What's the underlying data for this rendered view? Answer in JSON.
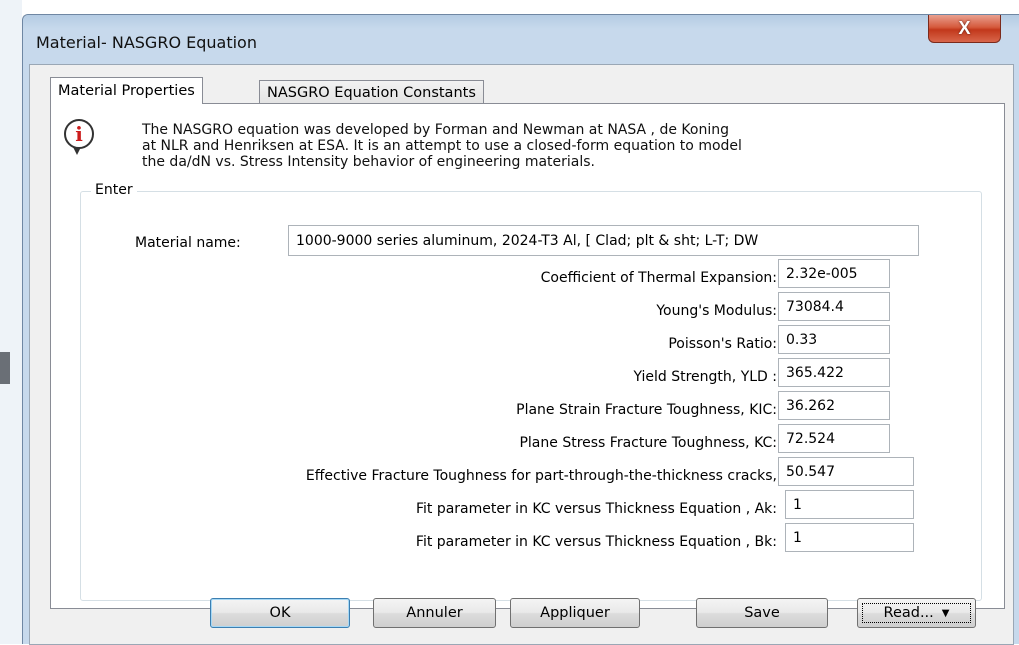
{
  "window": {
    "title": "Material- NASGRO Equation",
    "close_glyph": "X"
  },
  "tabs": [
    {
      "label": "Material Properties",
      "selected": true
    },
    {
      "label": "NASGRO Equation Constants",
      "selected": false
    }
  ],
  "info": {
    "icon": "info-icon",
    "lines": [
      "The NASGRO equation was developed by Forman and Newman at NASA , de Koning",
      "at NLR and Henriksen at ESA. It is an attempt to use a closed-form equation to model",
      "the da/dN vs. Stress Intensity behavior of engineering materials."
    ]
  },
  "group": {
    "legend": "Enter"
  },
  "material_name": {
    "label": "Material name:",
    "value": "1000-9000 series aluminum,  2024-T3 Al, [ Clad; plt & sht; L-T; DW"
  },
  "properties": [
    {
      "label": "Coefficient of Thermal Expansion:",
      "value": "2.32e-005"
    },
    {
      "label": "Young's Modulus:",
      "value": "73084.4"
    },
    {
      "label": "Poisson's Ratio:",
      "value": "0.33"
    },
    {
      "label": "Yield Strength, YLD :",
      "value": "365.422"
    },
    {
      "label": "Plane Strain Fracture Toughness, KIC:",
      "value": "36.262"
    },
    {
      "label": "Plane Stress Fracture Toughness, KC:",
      "value": "72.524"
    },
    {
      "label": "Effective Fracture Toughness for part-through-the-thickness cracks,",
      "value": "50.547"
    },
    {
      "label": "Fit parameter in KC  versus Thickness Equation , Ak:",
      "value": "1"
    },
    {
      "label": "Fit parameter in KC  versus Thickness Equation , Bk:",
      "value": "1"
    }
  ],
  "buttons": {
    "ok": "OK",
    "cancel": "Annuler",
    "apply": "Appliquer",
    "save": "Save",
    "read": "Read...",
    "read_arrow": "▼"
  },
  "colors": {
    "window_frame": "#c7d9ec",
    "close_button": "#c2381b",
    "info_icon_accent": "#cc1d1d"
  }
}
